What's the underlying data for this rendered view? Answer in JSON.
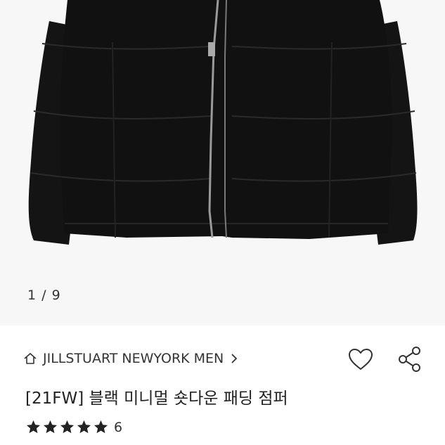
{
  "gallery": {
    "image_icon": "black-puffer-jacket",
    "counter": "1 / 9",
    "current": 1,
    "total": 9
  },
  "brand": {
    "home_icon": "home-icon",
    "name": "JILLSTUART NEWYORK MEN",
    "chevron_icon": "chevron-right-icon"
  },
  "actions": {
    "like_icon": "heart-icon",
    "share_icon": "share-icon"
  },
  "product": {
    "title": "[21FW] 블랙 미니멀 숏다운 패딩 점퍼"
  },
  "rating": {
    "stars": 5,
    "max_stars": 5,
    "review_count": "6"
  },
  "colors": {
    "background": "#ffffff",
    "image_background": "#f7f7f7",
    "jacket": "#121212",
    "text": "#222222"
  }
}
